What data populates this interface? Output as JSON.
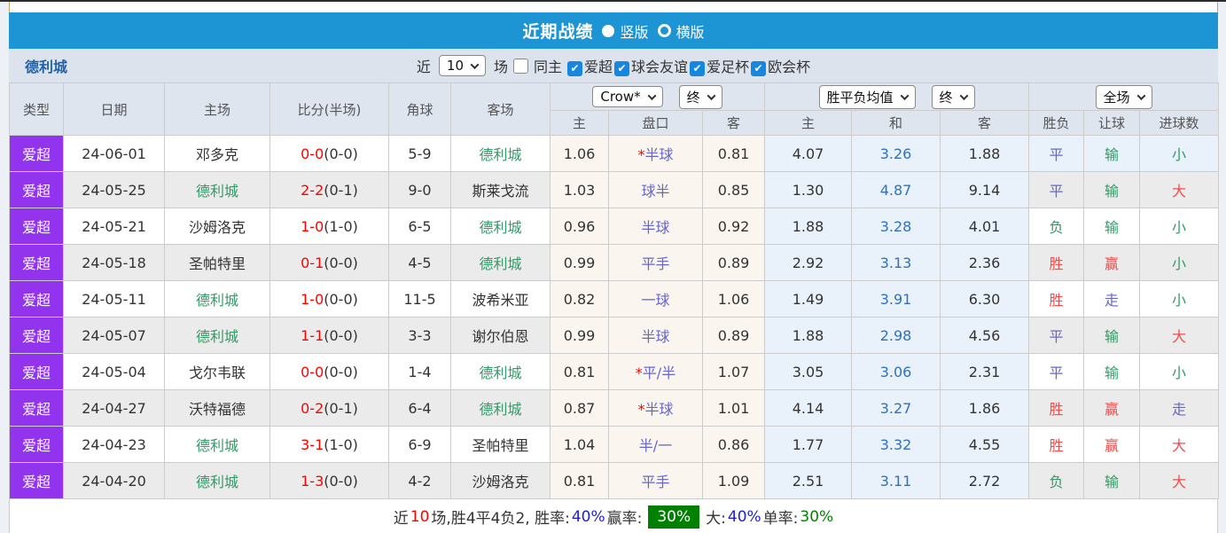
{
  "title_bar": {
    "title": "近期战绩",
    "radio_options": [
      {
        "label": "竖版",
        "selected": true
      },
      {
        "label": "横版",
        "selected": false
      }
    ]
  },
  "filter_bar": {
    "team_name": "德利城",
    "near_label": "近",
    "matches_value": "10",
    "games_label": "场",
    "same_home_label": "同主",
    "same_home_checked": false,
    "league_filters": [
      {
        "label": "爱超",
        "checked": true
      },
      {
        "label": "球会友谊",
        "checked": true
      },
      {
        "label": "爱足杯",
        "checked": true
      },
      {
        "label": "欧会杯",
        "checked": true
      }
    ]
  },
  "table": {
    "main_headers": [
      "类型",
      "日期",
      "主场",
      "比分(半场)",
      "角球",
      "客场"
    ],
    "dropdowns": {
      "company": "Crow*",
      "company_state": "终",
      "average": "胜平负均值",
      "average_state": "终",
      "full_match": "全场"
    },
    "sub_headers": [
      "主",
      "盘口",
      "客",
      "主",
      "和",
      "客",
      "胜负",
      "让球",
      "进球数"
    ],
    "rows": [
      {
        "league": "爱超",
        "date": "24-06-01",
        "home": "邓多克",
        "home_focus": false,
        "score": "0-0",
        "half": "(0-0)",
        "corners": "5-9",
        "away": "德利城",
        "away_focus": true,
        "odds_home": "1.06",
        "handicap": "半球",
        "handicap_star": true,
        "odds_away": "0.81",
        "avg_home": "4.07",
        "avg_draw": "3.26",
        "avg_away": "1.88",
        "result": "平",
        "result_color": "blue",
        "let_result": "输",
        "let_color": "green",
        "goals": "小",
        "goals_color": "green",
        "highlight": true
      },
      {
        "league": "爱超",
        "date": "24-05-25",
        "home": "德利城",
        "home_focus": true,
        "score": "2-2",
        "half": "(0-1)",
        "corners": "9-0",
        "away": "斯莱戈流",
        "away_focus": false,
        "odds_home": "1.03",
        "handicap": "球半",
        "handicap_star": false,
        "odds_away": "0.85",
        "avg_home": "1.30",
        "avg_draw": "4.87",
        "avg_away": "9.14",
        "result": "平",
        "result_color": "blue",
        "let_result": "输",
        "let_color": "green",
        "goals": "大",
        "goals_color": "red",
        "highlight": false
      },
      {
        "league": "爱超",
        "date": "24-05-21",
        "home": "沙姆洛克",
        "home_focus": false,
        "score": "1-0",
        "half": "(1-0)",
        "corners": "6-5",
        "away": "德利城",
        "away_focus": true,
        "odds_home": "0.96",
        "handicap": "半球",
        "handicap_star": false,
        "odds_away": "0.92",
        "avg_home": "1.88",
        "avg_draw": "3.28",
        "avg_away": "4.01",
        "result": "负",
        "result_color": "green",
        "let_result": "输",
        "let_color": "green",
        "goals": "小",
        "goals_color": "green",
        "highlight": false
      },
      {
        "league": "爱超",
        "date": "24-05-18",
        "home": "圣帕特里",
        "home_focus": false,
        "score": "0-1",
        "half": "(0-0)",
        "corners": "4-5",
        "away": "德利城",
        "away_focus": true,
        "odds_home": "0.99",
        "handicap": "平手",
        "handicap_star": false,
        "odds_away": "0.89",
        "avg_home": "2.92",
        "avg_draw": "3.13",
        "avg_away": "2.36",
        "result": "胜",
        "result_color": "red",
        "let_result": "赢",
        "let_color": "red",
        "goals": "小",
        "goals_color": "green",
        "highlight": false
      },
      {
        "league": "爱超",
        "date": "24-05-11",
        "home": "德利城",
        "home_focus": true,
        "score": "1-0",
        "half": "(0-0)",
        "corners": "11-5",
        "away": "波希米亚",
        "away_focus": false,
        "odds_home": "0.82",
        "handicap": "一球",
        "handicap_star": false,
        "odds_away": "1.06",
        "avg_home": "1.49",
        "avg_draw": "3.91",
        "avg_away": "6.30",
        "result": "胜",
        "result_color": "red",
        "let_result": "走",
        "let_color": "blue",
        "goals": "小",
        "goals_color": "green",
        "highlight": false
      },
      {
        "league": "爱超",
        "date": "24-05-07",
        "home": "德利城",
        "home_focus": true,
        "score": "1-1",
        "half": "(0-0)",
        "corners": "3-3",
        "away": "谢尔伯恩",
        "away_focus": false,
        "odds_home": "0.99",
        "handicap": "半球",
        "handicap_star": false,
        "odds_away": "0.89",
        "avg_home": "1.88",
        "avg_draw": "2.98",
        "avg_away": "4.56",
        "result": "平",
        "result_color": "blue",
        "let_result": "输",
        "let_color": "green",
        "goals": "大",
        "goals_color": "red",
        "highlight": false
      },
      {
        "league": "爱超",
        "date": "24-05-04",
        "home": "戈尔韦联",
        "home_focus": false,
        "score": "0-0",
        "half": "(0-0)",
        "corners": "1-4",
        "away": "德利城",
        "away_focus": true,
        "odds_home": "0.81",
        "handicap": "平/半",
        "handicap_star": true,
        "odds_away": "1.07",
        "avg_home": "3.05",
        "avg_draw": "3.06",
        "avg_away": "2.31",
        "result": "平",
        "result_color": "blue",
        "let_result": "输",
        "let_color": "green",
        "goals": "小",
        "goals_color": "green",
        "highlight": false
      },
      {
        "league": "爱超",
        "date": "24-04-27",
        "home": "沃特福德",
        "home_focus": false,
        "score": "0-2",
        "half": "(0-1)",
        "corners": "6-4",
        "away": "德利城",
        "away_focus": true,
        "odds_home": "0.87",
        "handicap": "半球",
        "handicap_star": true,
        "odds_away": "1.01",
        "avg_home": "4.14",
        "avg_draw": "3.27",
        "avg_away": "1.86",
        "result": "胜",
        "result_color": "red",
        "let_result": "赢",
        "let_color": "red",
        "goals": "走",
        "goals_color": "blue",
        "highlight": false
      },
      {
        "league": "爱超",
        "date": "24-04-23",
        "home": "德利城",
        "home_focus": true,
        "score": "3-1",
        "half": "(1-0)",
        "corners": "6-9",
        "away": "圣帕特里",
        "away_focus": false,
        "odds_home": "1.04",
        "handicap": "半/一",
        "handicap_star": false,
        "odds_away": "0.86",
        "avg_home": "1.77",
        "avg_draw": "3.32",
        "avg_away": "4.55",
        "result": "胜",
        "result_color": "red",
        "let_result": "赢",
        "let_color": "red",
        "goals": "大",
        "goals_color": "red",
        "highlight": false
      },
      {
        "league": "爱超",
        "date": "24-04-20",
        "home": "德利城",
        "home_focus": true,
        "score": "1-3",
        "half": "(0-0)",
        "corners": "4-2",
        "away": "沙姆洛克",
        "away_focus": false,
        "odds_home": "0.81",
        "handicap": "平手",
        "handicap_star": false,
        "odds_away": "1.09",
        "avg_home": "2.51",
        "avg_draw": "3.11",
        "avg_away": "2.72",
        "result": "负",
        "result_color": "green",
        "let_result": "输",
        "let_color": "green",
        "goals": "大",
        "goals_color": "red",
        "highlight": false
      }
    ]
  },
  "footer": {
    "segments": [
      {
        "text": "近",
        "style": "black"
      },
      {
        "text": "10",
        "style": "red"
      },
      {
        "text": "场,胜4平4负2, 胜率:",
        "style": "black"
      },
      {
        "text": "40%",
        "style": "blue"
      },
      {
        "text": " 赢率:",
        "style": "black"
      },
      {
        "text": "30%",
        "style": "green-badge"
      },
      {
        "text": "大:",
        "style": "black"
      },
      {
        "text": "40%",
        "style": "blue"
      },
      {
        "text": " 单率:",
        "style": "black"
      },
      {
        "text": "30%",
        "style": "green"
      }
    ]
  },
  "colors": {
    "title_bar_blue": "#1d94d3",
    "league_badge_purple": "#9233ee",
    "focus_team_green": "#339966",
    "score_red": "#ff0000",
    "handicap_blue": "#6666cc",
    "avg_draw_blue": "#3070bf",
    "win_red": "#f44b4b",
    "lose_green": "#339966",
    "draw_blue": "#6666cc",
    "odds_cell_cream": "#faf6ef",
    "avg_cell_blue": "#e9f2fa",
    "footer_green": "#008000"
  }
}
